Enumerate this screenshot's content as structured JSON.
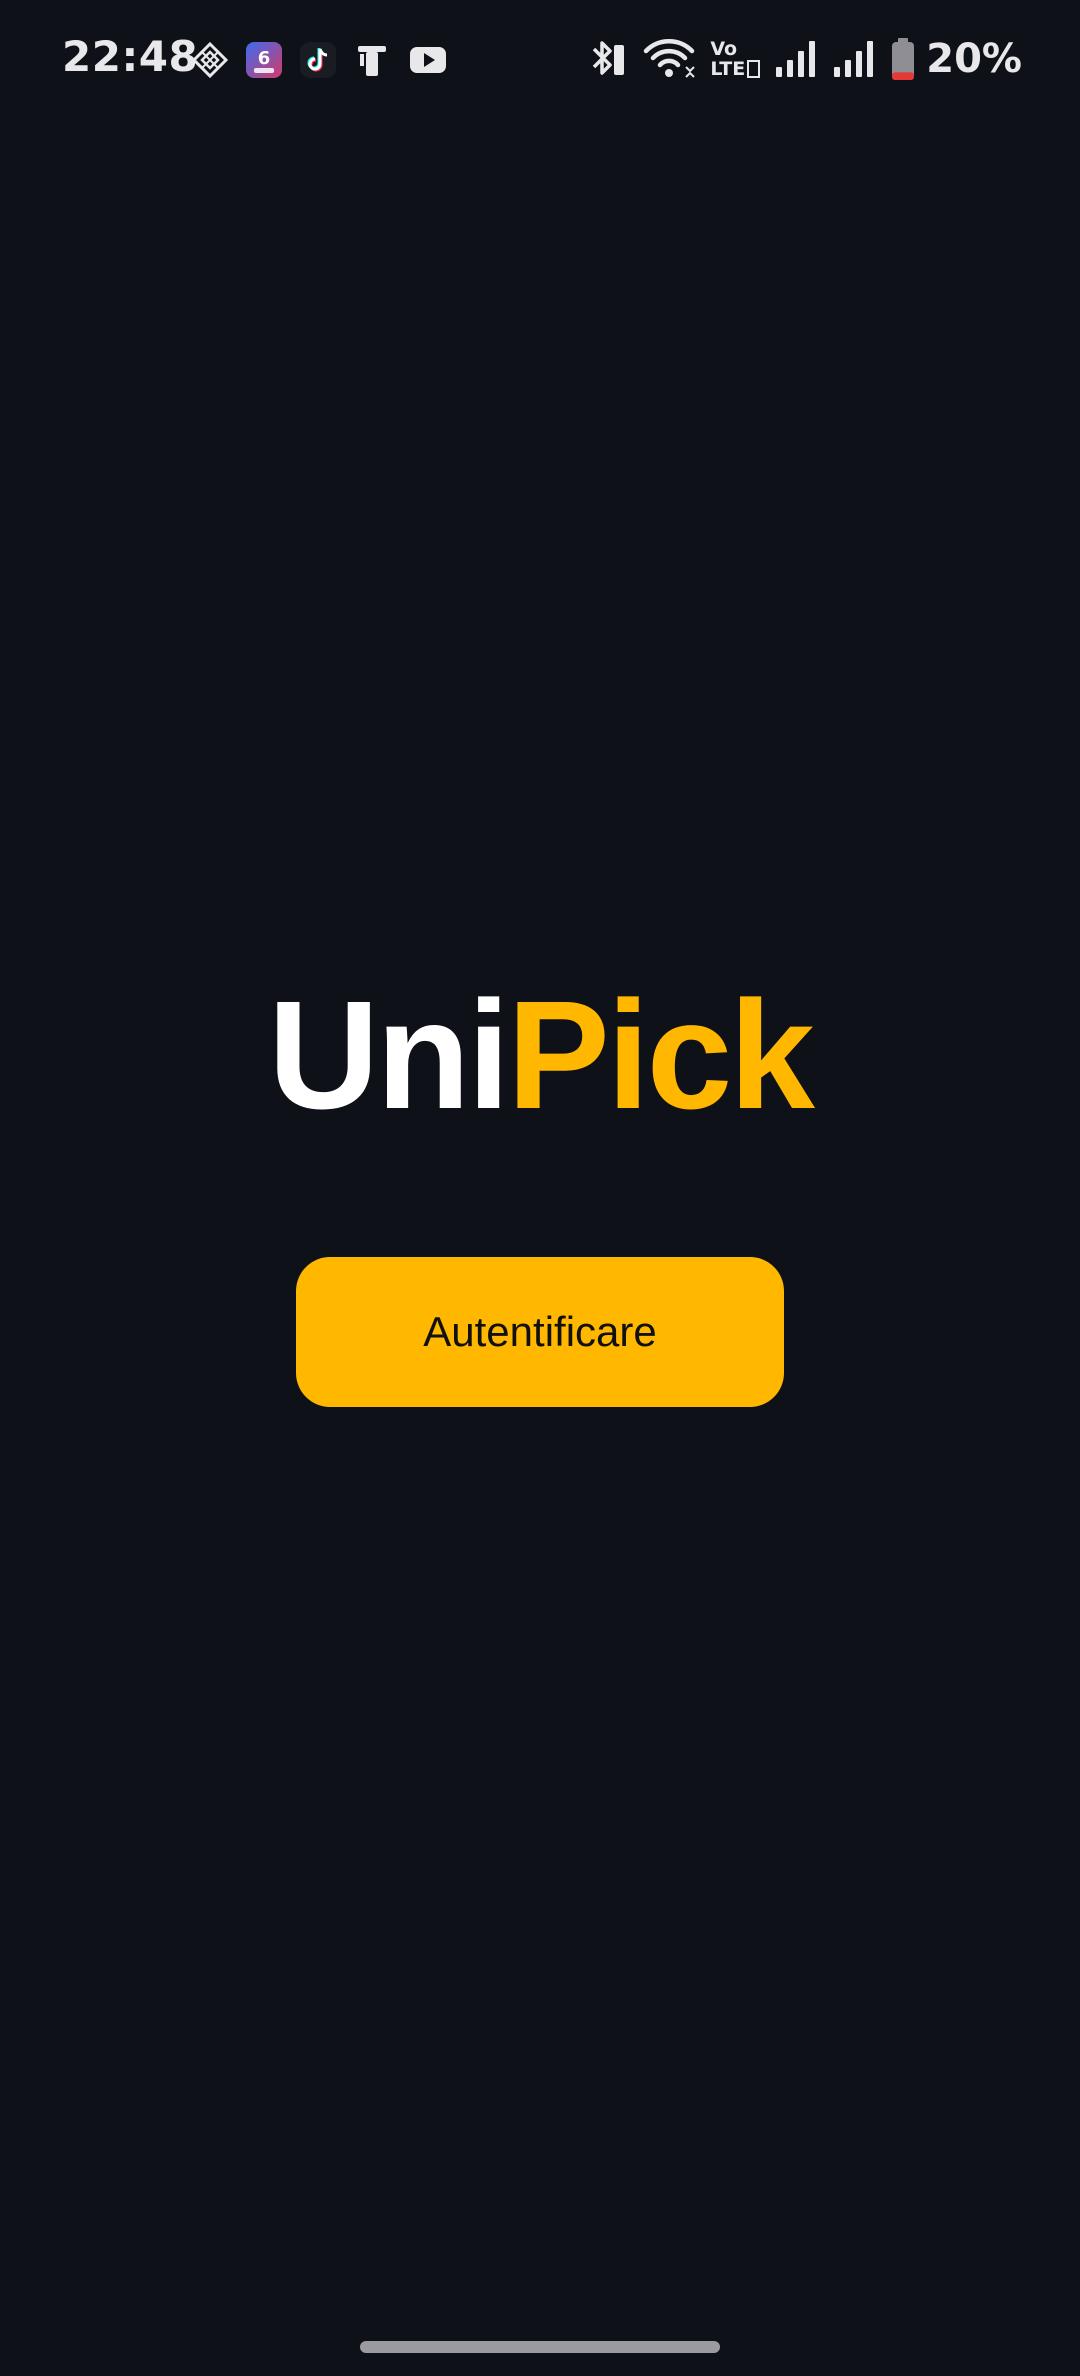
{
  "status_bar": {
    "time": "22:48",
    "battery_percent": "20%",
    "battery_level": 0.2,
    "notification_icons": [
      "vpn-diamond-icon",
      "app-six-icon",
      "tiktok-icon",
      "cast-icon",
      "youtube-icon"
    ],
    "system_icons": [
      "bluetooth-icon",
      "wifi-icon",
      "volte-icon",
      "signal-icon",
      "signal-icon",
      "battery-icon"
    ],
    "volte_label_top": "Vo",
    "volte_label_bottom": "LTE"
  },
  "logo": {
    "part_one": "Uni",
    "part_two": "Pick"
  },
  "auth": {
    "button_label": "Autentificare"
  },
  "colors": {
    "background": "#0f1118",
    "accent": "#ffb700",
    "logo_primary": "#ffffff",
    "battery_low": "#e53935"
  }
}
